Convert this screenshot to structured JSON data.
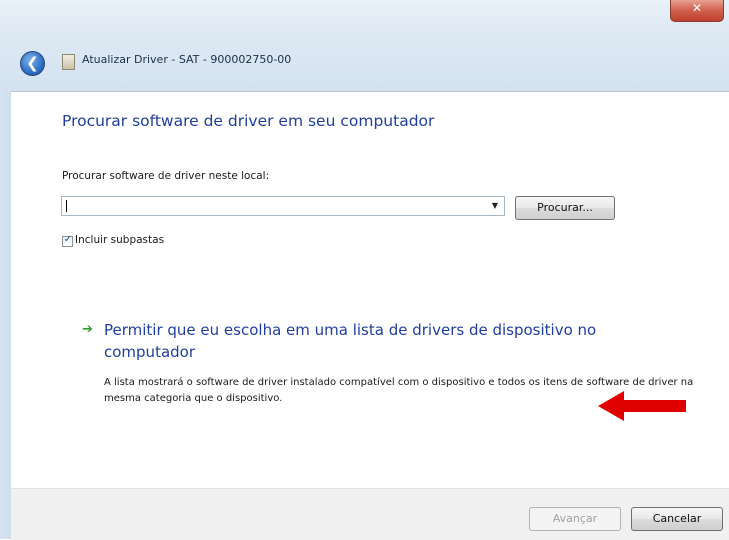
{
  "window": {
    "title": "Atualizar Driver - SAT - 900002750-00",
    "close_glyph": "✕",
    "back_glyph": "❮"
  },
  "page": {
    "heading": "Procurar software de driver em seu computador",
    "location_label": "Procurar software de driver neste local:",
    "path_value": "",
    "browse_label": "Procurar...",
    "include_subfolders_label": "Incluir subpastas",
    "include_subfolders_checked": true,
    "checkmark_glyph": "✓",
    "dropdown_glyph": "▼",
    "choose_list_link": "Permitir que eu escolha em uma lista de drivers de dispositivo no computador",
    "choose_list_description": "A lista mostrará o software de driver instalado compatível com o dispositivo e todos os itens de software de driver na mesma categoria que o dispositivo.",
    "arrow_glyph": "➔"
  },
  "footer": {
    "next_label": "Avançar",
    "cancel_label": "Cancelar"
  },
  "icons": {
    "back": "back-arrow-icon",
    "driver": "driver-icon",
    "dropdown": "chevron-down-icon",
    "link_arrow": "green-arrow-icon",
    "annotation": "red-arrow-icon"
  },
  "colors": {
    "heading_blue": "#1f3e9e",
    "close_red": "#c0402c",
    "link_arrow_green": "#2f9e2f",
    "annotation_red": "#e00000"
  }
}
